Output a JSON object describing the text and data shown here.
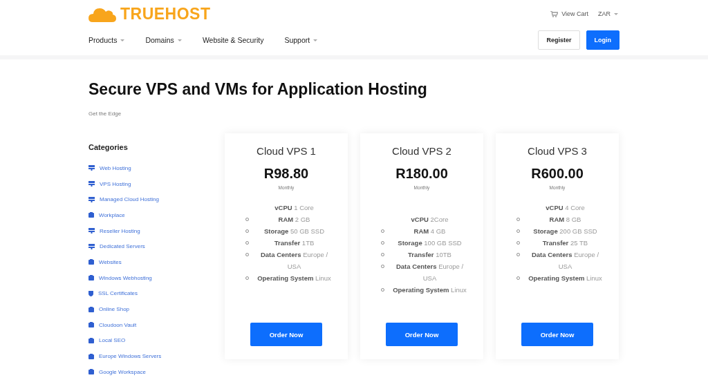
{
  "header": {
    "logo": "TRUEHOST",
    "cart": "View Cart",
    "currency": "ZAR",
    "nav": [
      {
        "label": "Products",
        "dropdown": true
      },
      {
        "label": "Domains",
        "dropdown": true
      },
      {
        "label": "Website & Security",
        "dropdown": false
      },
      {
        "label": "Support",
        "dropdown": true
      }
    ],
    "buttons": [
      {
        "label": "Register",
        "kind": "outline"
      },
      {
        "label": "Login",
        "kind": "primary"
      }
    ]
  },
  "page": {
    "title": "Secure VPS and VMs for Application Hosting",
    "subtitle": "Get the Edge"
  },
  "sidebar": {
    "title": "Categories",
    "items": [
      {
        "label": "Web Hosting",
        "kind": "server"
      },
      {
        "label": "VPS Hosting",
        "kind": "server"
      },
      {
        "label": "Managed Cloud Hosting",
        "kind": "server"
      },
      {
        "label": "Workplace",
        "kind": "box"
      },
      {
        "label": "Reseller Hosting",
        "kind": "server"
      },
      {
        "label": "Dedicated Servers",
        "kind": "server"
      },
      {
        "label": "Websites",
        "kind": "box"
      },
      {
        "label": "Windows Webhosting",
        "kind": "box"
      },
      {
        "label": "SSL Certificates",
        "kind": "shield"
      },
      {
        "label": "Online Shop",
        "kind": "box"
      },
      {
        "label": "Cloudoon Vault",
        "kind": "box"
      },
      {
        "label": "Local SEO",
        "kind": "box"
      },
      {
        "label": "Europe Windows Servers",
        "kind": "box"
      },
      {
        "label": "Google Workspace",
        "kind": "box"
      }
    ]
  },
  "plans": [
    {
      "name": "Cloud VPS 1",
      "price": "R98.80",
      "period": "Monthly",
      "leading_gap": false,
      "button": "Order Now",
      "features": [
        {
          "kind": "plain",
          "label": "vCPU",
          "value": "1 Core"
        },
        {
          "kind": "bullet",
          "label": "RAM",
          "value": "2 GB"
        },
        {
          "kind": "bullet",
          "label": "Storage",
          "value": "50 GB SSD"
        },
        {
          "kind": "bullet",
          "label": "Transfer",
          "value": "1TB"
        },
        {
          "kind": "bullet",
          "label": "Data Centers",
          "value": "Europe / USA"
        },
        {
          "kind": "bullet",
          "label": "Operating System",
          "value": "Linux"
        }
      ]
    },
    {
      "name": "Cloud VPS 2",
      "price": "R180.00",
      "period": "Monthly",
      "leading_gap": true,
      "button": "Order Now",
      "features": [
        {
          "kind": "plain",
          "label": "vCPU",
          "value": "2Core"
        },
        {
          "kind": "bullet",
          "label": "RAM",
          "value": "4 GB"
        },
        {
          "kind": "bullet",
          "label": "Storage",
          "value": "100 GB SSD"
        },
        {
          "kind": "bullet",
          "label": "Transfer",
          "value": "10TB"
        },
        {
          "kind": "bullet",
          "label": "Data Centers",
          "value": "Europe / USA"
        },
        {
          "kind": "bullet",
          "label": "Operating System",
          "value": "Linux"
        }
      ]
    },
    {
      "name": "Cloud VPS 3",
      "price": "R600.00",
      "period": "Monthly",
      "leading_gap": false,
      "button": "Order Now",
      "features": [
        {
          "kind": "plain",
          "label": "vCPU",
          "value": "4 Core"
        },
        {
          "kind": "bullet",
          "label": "RAM",
          "value": "8 GB"
        },
        {
          "kind": "bullet",
          "label": "Storage",
          "value": "200 GB SSD"
        },
        {
          "kind": "bullet",
          "label": "Transfer",
          "value": "25 TB"
        },
        {
          "kind": "bullet",
          "label": "Data Centers",
          "value": "Europe / USA"
        },
        {
          "kind": "bullet",
          "label": "Operating System",
          "value": "Linux"
        }
      ]
    }
  ]
}
